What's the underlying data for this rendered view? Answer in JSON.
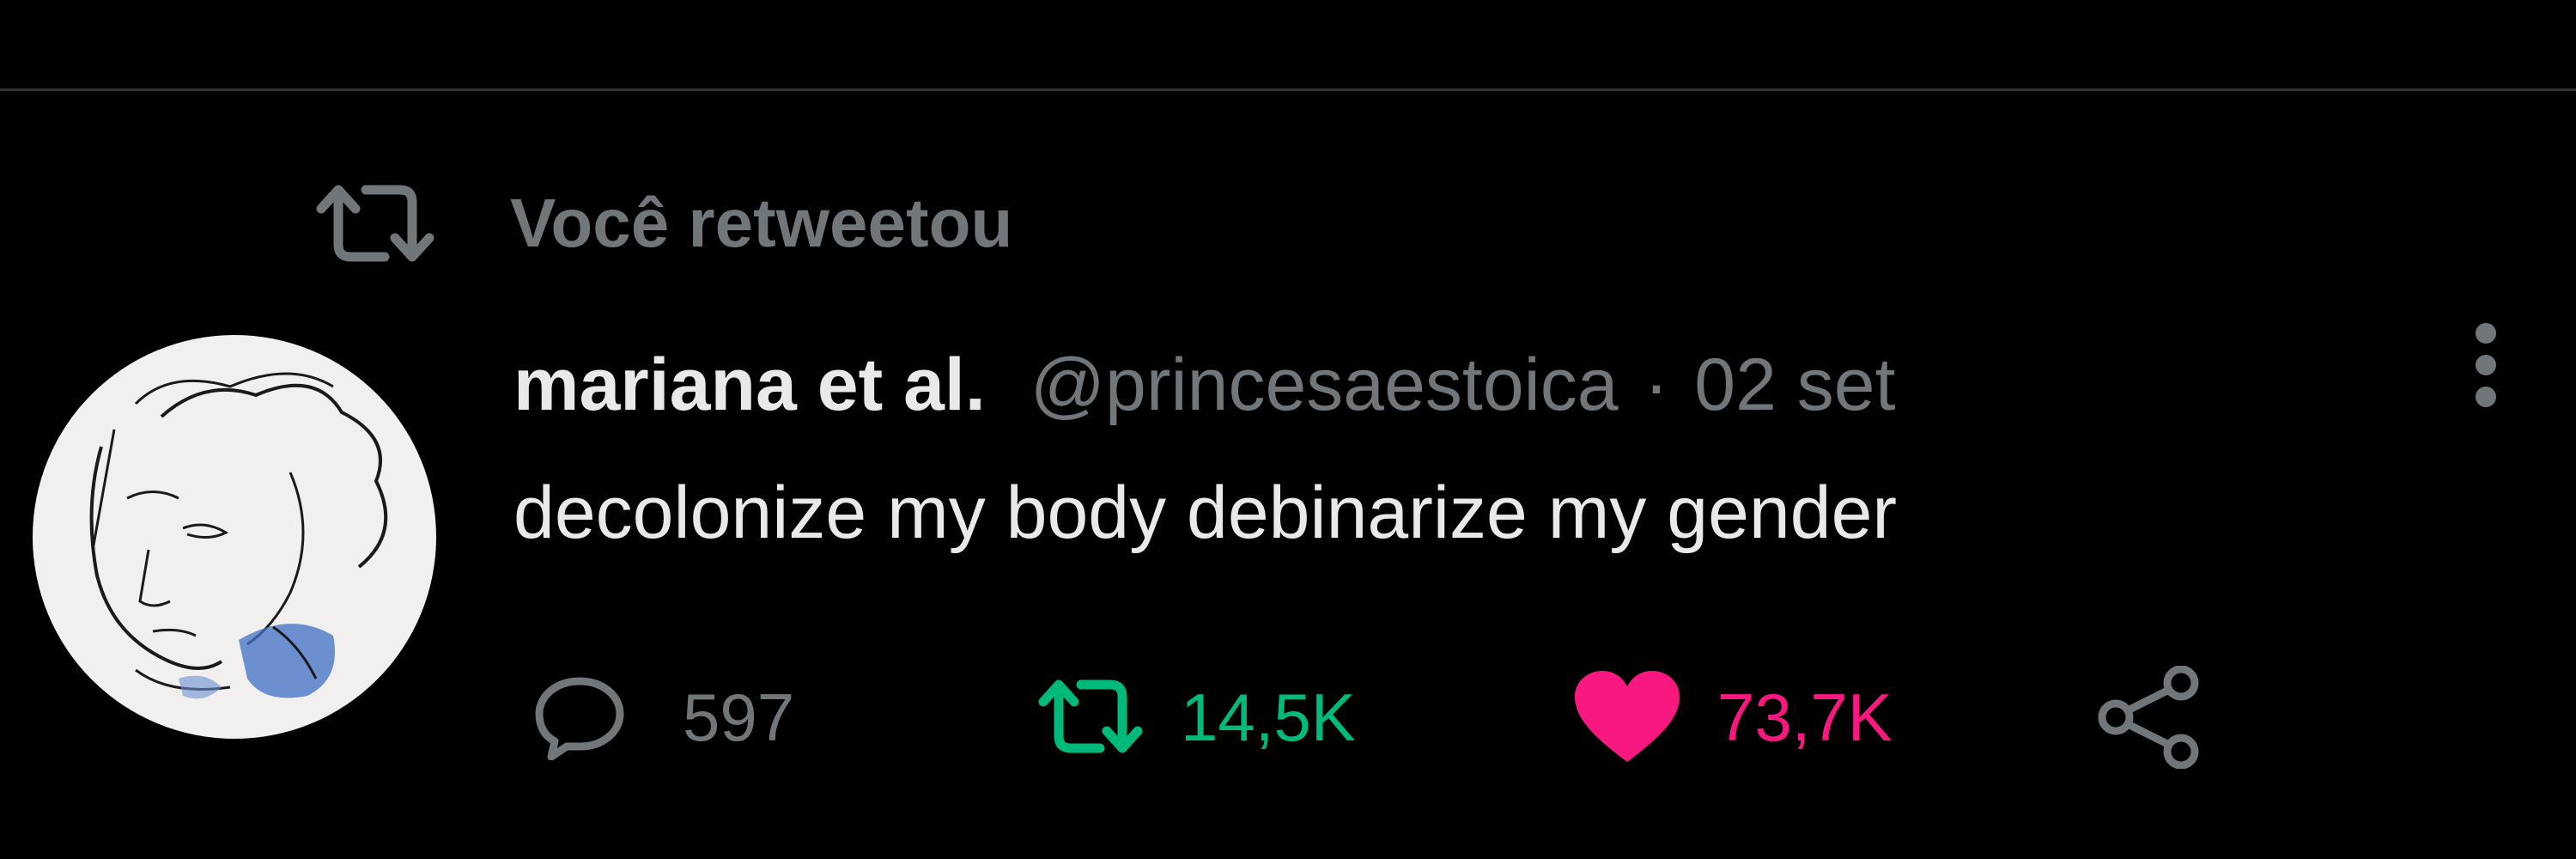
{
  "retweet_context": {
    "label": "Você retweetou",
    "icon": "retweet-icon"
  },
  "tweet": {
    "display_name": "mariana et al.",
    "handle": "@princesaestoica",
    "separator": "·",
    "date": "02 set",
    "text": "decolonize my body debinarize my gender"
  },
  "actions": {
    "reply": {
      "icon": "reply-bubble-icon",
      "count": "597"
    },
    "retweet": {
      "icon": "retweet-icon",
      "count": "14,5K",
      "active": true
    },
    "like": {
      "icon": "heart-icon",
      "count": "73,7K",
      "active": true
    },
    "share": {
      "icon": "share-icon"
    }
  },
  "colors": {
    "background": "#000000",
    "text_primary": "#e7e9ea",
    "text_secondary": "#71767b",
    "retweet_green": "#00ba7c",
    "like_pink": "#f91880",
    "divider": "#2f3336"
  }
}
